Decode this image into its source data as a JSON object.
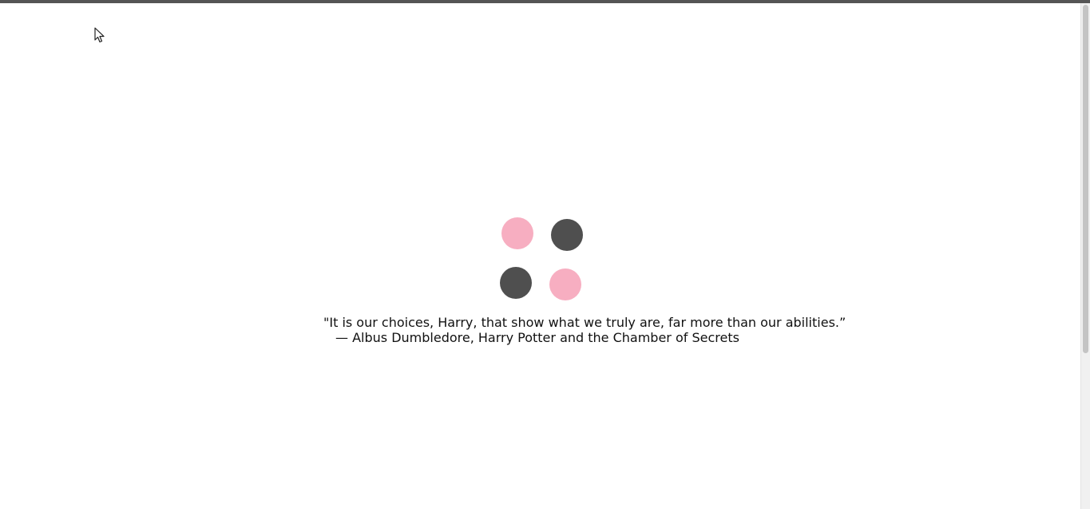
{
  "loader": {
    "colors": {
      "pink": "#f7aec1",
      "dark": "#4f4f4f"
    },
    "dots": [
      {
        "color": "pink"
      },
      {
        "color": "dark"
      },
      {
        "color": "dark"
      },
      {
        "color": "pink"
      }
    ]
  },
  "quote": {
    "text": "\"It is our choices, Harry, that show what we truly are, far more than our abilities.”",
    "attribution": "— Albus Dumbledore, Harry Potter and the Chamber of Secrets"
  },
  "icons": {
    "cursor": "mouse-pointer-icon"
  }
}
